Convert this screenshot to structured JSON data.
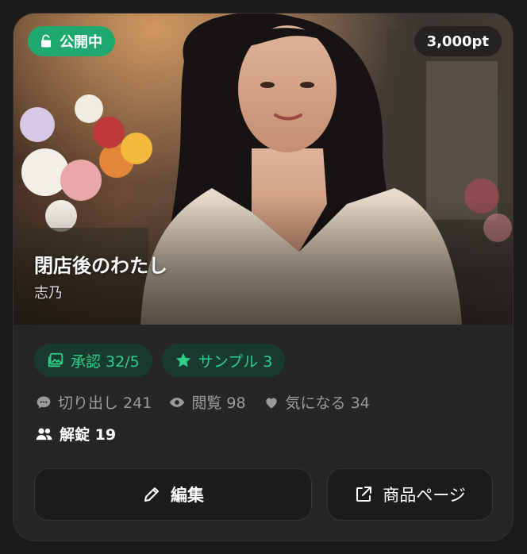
{
  "card": {
    "status_badge": "公開中",
    "points": "3,000pt",
    "title": "閉店後のわたし",
    "author": "志乃",
    "chips": [
      {
        "label": "承認 32/5",
        "icon": "image-icon"
      },
      {
        "label": "サンプル 3",
        "icon": "star-icon"
      }
    ],
    "stats": {
      "cutouts": "切り出し 241",
      "views": "閲覧 98",
      "interested": "気になる 34"
    },
    "unlocks": "解錠 19",
    "buttons": {
      "edit": "編集",
      "product_page": "商品ページ"
    }
  },
  "colors": {
    "accent_green": "#1fa971",
    "chip_text": "#2fcf8a",
    "chip_bg": "#193a2e",
    "card_bg": "#262627"
  }
}
